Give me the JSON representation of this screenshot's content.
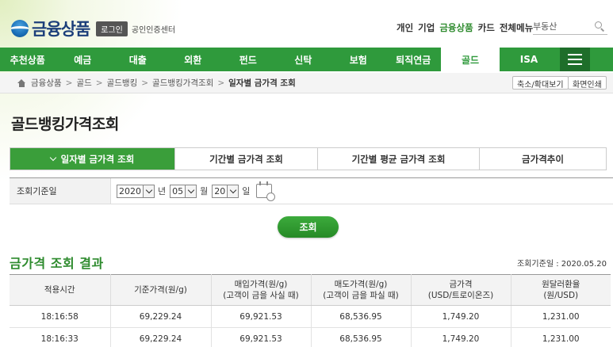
{
  "header": {
    "logo_text": "금융상품",
    "login_label": "로그인",
    "cert_label": "공인인증센터",
    "top_nav": [
      "개인",
      "기업",
      "금융상품",
      "카드",
      "전체메뉴"
    ],
    "top_nav_active": "금융상품",
    "search_value": "부동산",
    "brand_color": "#1c3f7a"
  },
  "menu": {
    "items": [
      "추천상품",
      "예금",
      "대출",
      "외환",
      "펀드",
      "신탁",
      "보험",
      "퇴직연금",
      "골드",
      "ISA"
    ],
    "active": "골드",
    "accent_color": "#2f9a3c"
  },
  "breadcrumb": {
    "items": [
      "금융상품",
      "골드",
      "골드뱅킹",
      "골드뱅킹가격조회",
      "일자별 금가격 조회"
    ],
    "zoom_label": "축소/확대보기",
    "print_label": "화면인쇄"
  },
  "page": {
    "title": "골드뱅킹가격조회"
  },
  "tabs": [
    "일자별 금가격 조회",
    "기간별 금가격 조회",
    "기간별 평균 금가격 조회",
    "금가격추이"
  ],
  "query": {
    "label": "조회기준일",
    "year": "2020",
    "year_unit": "년",
    "month": "05",
    "month_unit": "월",
    "day": "20",
    "day_unit": "일",
    "button_label": "조회"
  },
  "result": {
    "title": "금가격 조회 결과",
    "date_label": "조회기준일 : 2020.05.20",
    "headers": [
      [
        "적용시간",
        ""
      ],
      [
        "기준가격(원/g)",
        ""
      ],
      [
        "매입가격(원/g)",
        "(고객이 금을 사실 때)"
      ],
      [
        "매도가격(원/g)",
        "(고객이 금을 파실 때)"
      ],
      [
        "금가격",
        "(USD/트로이온즈)"
      ],
      [
        "원달러환율",
        "(원/USD)"
      ]
    ],
    "rows": [
      [
        "18:16:58",
        "69,229.24",
        "69,921.53",
        "68,536.95",
        "1,749.20",
        "1,231.00"
      ],
      [
        "18:16:33",
        "69,229.24",
        "69,921.53",
        "68,536.95",
        "1,749.20",
        "1,231.00"
      ]
    ]
  }
}
